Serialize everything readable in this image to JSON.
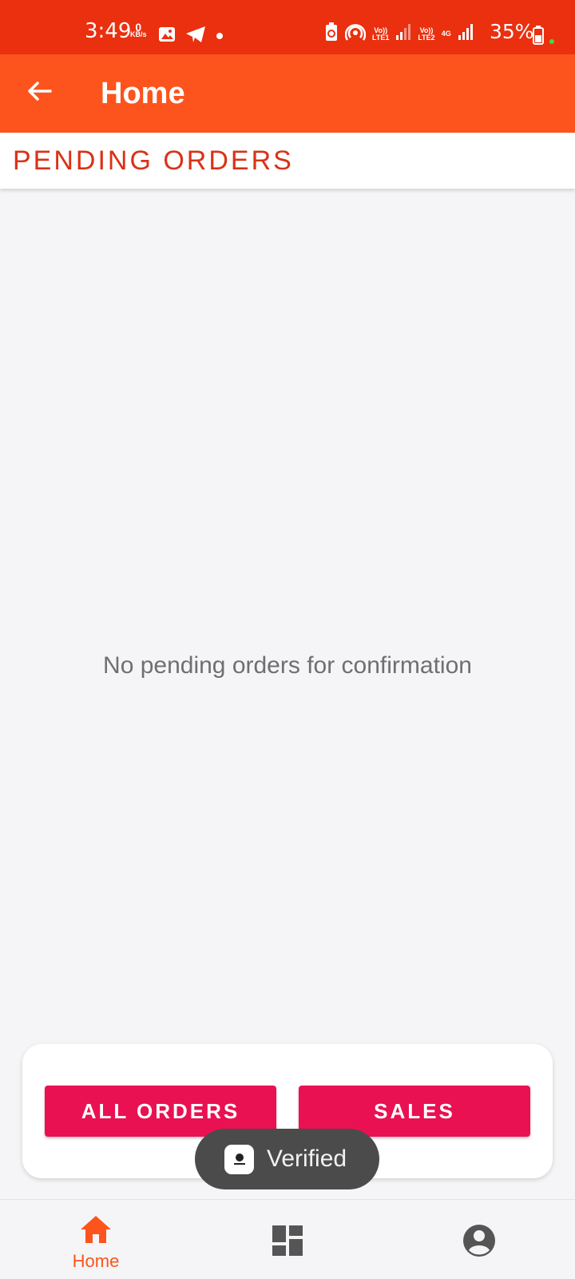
{
  "status_bar": {
    "time": "3:49",
    "speed_value": "0",
    "speed_unit": "KB/s",
    "sim1_label_top": "Vo))",
    "sim1_label_bottom": "LTE1",
    "sim2_label_top": "Vo))",
    "sim2_label_bottom": "LTE2",
    "network_type": "4G",
    "battery": "35%",
    "icons": [
      "gallery-icon",
      "telegram-icon",
      "dot-icon",
      "battery-saver-icon",
      "hotspot-icon",
      "signal-icon",
      "battery-icon"
    ]
  },
  "app_bar": {
    "title": "Home",
    "back_icon": "arrow-back-icon"
  },
  "tab": {
    "label": "PENDING ORDERS"
  },
  "content": {
    "empty_message": "No pending orders for confirmation"
  },
  "actions": {
    "all_orders_label": "ALL ORDERS",
    "sales_label": "SALES"
  },
  "toast": {
    "text": "Verified"
  },
  "bottom_nav": {
    "items": [
      {
        "label": "Home",
        "icon": "home-icon",
        "active": true
      },
      {
        "label": "",
        "icon": "dashboard-icon",
        "active": false
      },
      {
        "label": "",
        "icon": "account-icon",
        "active": false
      }
    ]
  },
  "colors": {
    "status_bar": "#ea300f",
    "app_bar": "#fc541c",
    "tab_text": "#d93217",
    "button": "#e91152",
    "toast_bg": "#4b4b4b",
    "nav_active": "#fc541c",
    "nav_inactive": "#555555"
  }
}
